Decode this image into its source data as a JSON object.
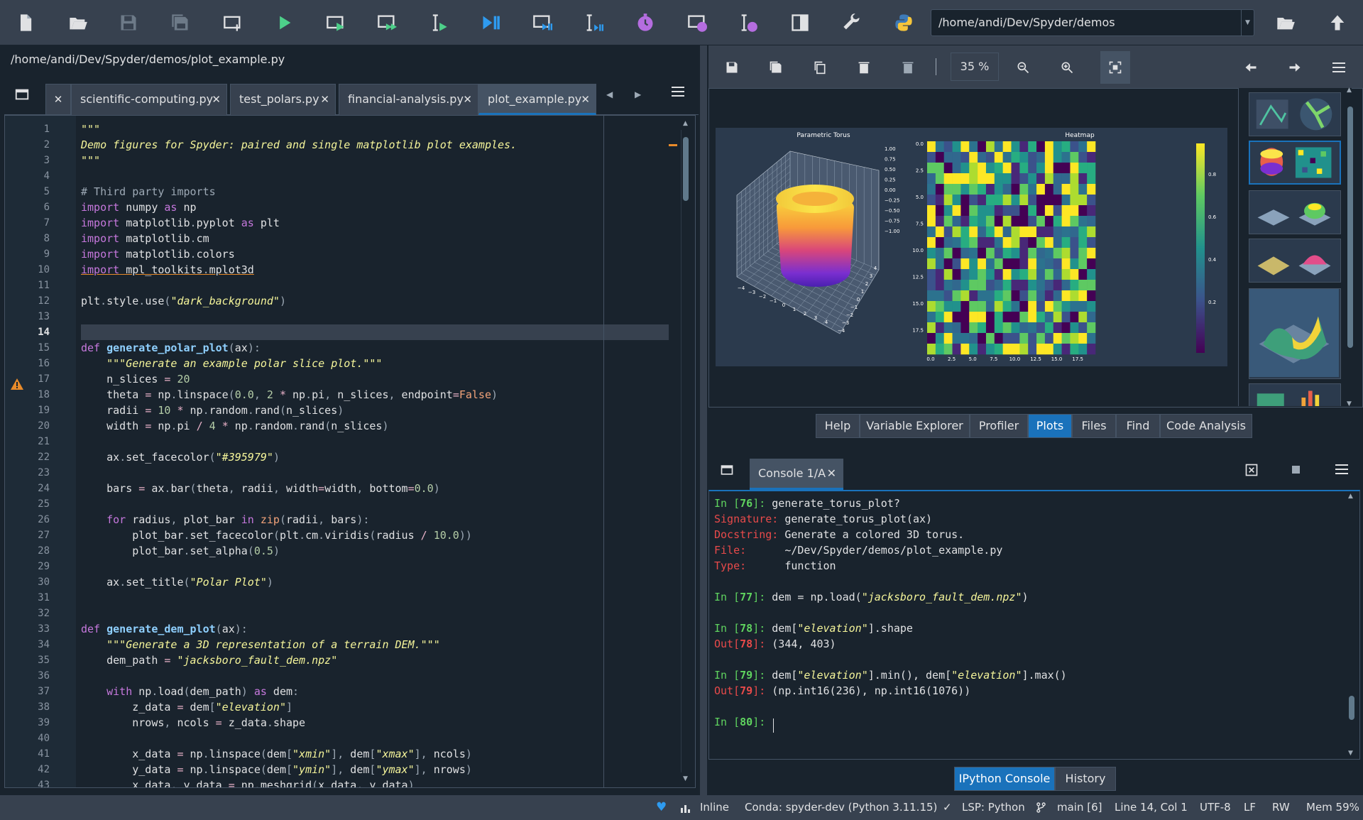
{
  "toolbar": {
    "path": "/home/andi/Dev/Spyder/demos",
    "icons": [
      "new-file-icon",
      "open-file-icon",
      "save-icon",
      "save-all-icon",
      "new-cell-icon",
      "run-icon",
      "run-cell-icon",
      "run-cell-advance-icon",
      "run-selection-icon",
      "debug-icon",
      "debug-cell-icon",
      "debug-selection-icon",
      "profile-icon",
      "profile-cell-icon",
      "profile-selection-icon",
      "maximize-pane-icon",
      "preferences-icon",
      "python-path-icon",
      "browse-folder-icon",
      "parent-dir-icon"
    ]
  },
  "editor": {
    "filepath": "/home/andi/Dev/Spyder/demos/plot_example.py",
    "tabs": [
      {
        "label": "scientific-computing.py"
      },
      {
        "label": "test_polars.py"
      },
      {
        "label": "financial-analysis.py"
      },
      {
        "label": "plot_example.py"
      }
    ],
    "close_glyph": "✕",
    "current_line": 14,
    "line_numbers": [
      "1",
      "2",
      "3",
      "4",
      "5",
      "6",
      "7",
      "8",
      "9",
      "10",
      "11",
      "12",
      "13",
      "14",
      "15",
      "16",
      "17",
      "18",
      "19",
      "20",
      "21",
      "22",
      "23",
      "24",
      "25",
      "26",
      "27",
      "28",
      "29",
      "30",
      "31",
      "32",
      "33",
      "34",
      "35",
      "36",
      "37",
      "38",
      "39",
      "40",
      "41",
      "42",
      "43"
    ],
    "code": [
      [
        [
          "st",
          "\"\"\""
        ]
      ],
      [
        [
          "st",
          "Demo figures for Spyder: paired and single matplotlib plot examples."
        ]
      ],
      [
        [
          "st",
          "\"\"\""
        ]
      ],
      [],
      [
        [
          "cm",
          "# Third party imports"
        ]
      ],
      [
        [
          "kw",
          "import"
        ],
        [
          "t",
          " numpy "
        ],
        [
          "kw",
          "as"
        ],
        [
          "t",
          " np"
        ]
      ],
      [
        [
          "kw",
          "import"
        ],
        [
          "t",
          " matplotlib"
        ],
        [
          "c",
          "."
        ],
        [
          "t",
          "pyplot "
        ],
        [
          "kw",
          "as"
        ],
        [
          "t",
          " plt"
        ]
      ],
      [
        [
          "kw",
          "import"
        ],
        [
          "t",
          " matplotlib"
        ],
        [
          "c",
          "."
        ],
        [
          "t",
          "cm"
        ]
      ],
      [
        [
          "kw",
          "import"
        ],
        [
          "t",
          " matplotlib"
        ],
        [
          "c",
          "."
        ],
        [
          "t",
          "colors"
        ]
      ],
      [
        [
          "kwu",
          "import"
        ],
        [
          "tu",
          " mpl_toolkits"
        ],
        [
          "cu",
          "."
        ],
        [
          "tu",
          "mplot3d"
        ]
      ],
      [],
      [
        [
          "t",
          "plt"
        ],
        [
          "c",
          "."
        ],
        [
          "t",
          "style"
        ],
        [
          "c",
          "."
        ],
        [
          "t",
          "use"
        ],
        [
          "c",
          "("
        ],
        [
          "st",
          "\"dark_background\""
        ],
        [
          "c",
          ")"
        ]
      ],
      [],
      [],
      [
        [
          "kw",
          "def"
        ],
        [
          "t",
          " "
        ],
        [
          "f",
          "generate_polar_plot"
        ],
        [
          "c",
          "("
        ],
        [
          "t",
          "ax"
        ],
        [
          "c",
          "):"
        ]
      ],
      [
        [
          "t",
          "    "
        ],
        [
          "st",
          "\"\"\"Generate an example polar slice plot.\"\"\""
        ]
      ],
      [
        [
          "t",
          "    n_slices "
        ],
        [
          "o",
          "="
        ],
        [
          "t",
          " "
        ],
        [
          "num",
          "20"
        ]
      ],
      [
        [
          "t",
          "    theta "
        ],
        [
          "o",
          "="
        ],
        [
          "t",
          " np"
        ],
        [
          "c",
          "."
        ],
        [
          "t",
          "linspace"
        ],
        [
          "c",
          "("
        ],
        [
          "num",
          "0.0"
        ],
        [
          "c",
          ","
        ],
        [
          "t",
          " "
        ],
        [
          "num",
          "2"
        ],
        [
          "t",
          " "
        ],
        [
          "o",
          "*"
        ],
        [
          "t",
          " np"
        ],
        [
          "c",
          "."
        ],
        [
          "t",
          "pi"
        ],
        [
          "c",
          ","
        ],
        [
          "t",
          " n_slices"
        ],
        [
          "c",
          ","
        ],
        [
          "t",
          " endpoint"
        ],
        [
          "o",
          "="
        ],
        [
          "sy",
          "False"
        ],
        [
          "c",
          ")"
        ]
      ],
      [
        [
          "t",
          "    radii "
        ],
        [
          "o",
          "="
        ],
        [
          "t",
          " "
        ],
        [
          "num",
          "10"
        ],
        [
          "t",
          " "
        ],
        [
          "o",
          "*"
        ],
        [
          "t",
          " np"
        ],
        [
          "c",
          "."
        ],
        [
          "t",
          "random"
        ],
        [
          "c",
          "."
        ],
        [
          "t",
          "rand"
        ],
        [
          "c",
          "("
        ],
        [
          "t",
          "n_slices"
        ],
        [
          "c",
          ")"
        ]
      ],
      [
        [
          "t",
          "    width "
        ],
        [
          "o",
          "="
        ],
        [
          "t",
          " np"
        ],
        [
          "c",
          "."
        ],
        [
          "t",
          "pi "
        ],
        [
          "o",
          "/"
        ],
        [
          "t",
          " "
        ],
        [
          "num",
          "4"
        ],
        [
          "t",
          " "
        ],
        [
          "o",
          "*"
        ],
        [
          "t",
          " np"
        ],
        [
          "c",
          "."
        ],
        [
          "t",
          "random"
        ],
        [
          "c",
          "."
        ],
        [
          "t",
          "rand"
        ],
        [
          "c",
          "("
        ],
        [
          "t",
          "n_slices"
        ],
        [
          "c",
          ")"
        ]
      ],
      [],
      [
        [
          "t",
          "    ax"
        ],
        [
          "c",
          "."
        ],
        [
          "t",
          "set_facecolor"
        ],
        [
          "c",
          "("
        ],
        [
          "st",
          "\"#395979\""
        ],
        [
          "c",
          ")"
        ]
      ],
      [],
      [
        [
          "t",
          "    bars "
        ],
        [
          "o",
          "="
        ],
        [
          "t",
          " ax"
        ],
        [
          "c",
          "."
        ],
        [
          "t",
          "bar"
        ],
        [
          "c",
          "("
        ],
        [
          "t",
          "theta"
        ],
        [
          "c",
          ","
        ],
        [
          "t",
          " radii"
        ],
        [
          "c",
          ","
        ],
        [
          "t",
          " width"
        ],
        [
          "o",
          "="
        ],
        [
          "t",
          "width"
        ],
        [
          "c",
          ","
        ],
        [
          "t",
          " bottom"
        ],
        [
          "o",
          "="
        ],
        [
          "num",
          "0.0"
        ],
        [
          "c",
          ")"
        ]
      ],
      [],
      [
        [
          "t",
          "    "
        ],
        [
          "kw",
          "for"
        ],
        [
          "t",
          " radius"
        ],
        [
          "c",
          ","
        ],
        [
          "t",
          " plot_bar "
        ],
        [
          "kw",
          "in"
        ],
        [
          "t",
          " "
        ],
        [
          "sy",
          "zip"
        ],
        [
          "c",
          "("
        ],
        [
          "t",
          "radii"
        ],
        [
          "c",
          ","
        ],
        [
          "t",
          " bars"
        ],
        [
          "c",
          "):"
        ]
      ],
      [
        [
          "t",
          "        plot_bar"
        ],
        [
          "c",
          "."
        ],
        [
          "t",
          "set_facecolor"
        ],
        [
          "c",
          "("
        ],
        [
          "t",
          "plt"
        ],
        [
          "c",
          "."
        ],
        [
          "t",
          "cm"
        ],
        [
          "c",
          "."
        ],
        [
          "t",
          "viridis"
        ],
        [
          "c",
          "("
        ],
        [
          "t",
          "radius "
        ],
        [
          "o",
          "/"
        ],
        [
          "t",
          " "
        ],
        [
          "num",
          "10.0"
        ],
        [
          "c",
          "))"
        ]
      ],
      [
        [
          "t",
          "        plot_bar"
        ],
        [
          "c",
          "."
        ],
        [
          "t",
          "set_alpha"
        ],
        [
          "c",
          "("
        ],
        [
          "num",
          "0.5"
        ],
        [
          "c",
          ")"
        ]
      ],
      [],
      [
        [
          "t",
          "    ax"
        ],
        [
          "c",
          "."
        ],
        [
          "t",
          "set_title"
        ],
        [
          "c",
          "("
        ],
        [
          "st",
          "\"Polar Plot\""
        ],
        [
          "c",
          ")"
        ]
      ],
      [],
      [],
      [
        [
          "kw",
          "def"
        ],
        [
          "t",
          " "
        ],
        [
          "f",
          "generate_dem_plot"
        ],
        [
          "c",
          "("
        ],
        [
          "t",
          "ax"
        ],
        [
          "c",
          "):"
        ]
      ],
      [
        [
          "t",
          "    "
        ],
        [
          "st",
          "\"\"\"Generate a 3D representation of a terrain DEM.\"\"\""
        ]
      ],
      [
        [
          "t",
          "    dem_path "
        ],
        [
          "o",
          "="
        ],
        [
          "t",
          " "
        ],
        [
          "st",
          "\"jacksboro_fault_dem.npz\""
        ]
      ],
      [],
      [
        [
          "t",
          "    "
        ],
        [
          "kw",
          "with"
        ],
        [
          "t",
          " np"
        ],
        [
          "c",
          "."
        ],
        [
          "t",
          "load"
        ],
        [
          "c",
          "("
        ],
        [
          "t",
          "dem_path"
        ],
        [
          "c",
          ")"
        ],
        [
          "t",
          " "
        ],
        [
          "kw",
          "as"
        ],
        [
          "t",
          " dem"
        ],
        [
          "c",
          ":"
        ]
      ],
      [
        [
          "t",
          "        z_data "
        ],
        [
          "o",
          "="
        ],
        [
          "t",
          " dem"
        ],
        [
          "c",
          "["
        ],
        [
          "st",
          "\"elevation\""
        ],
        [
          "c",
          "]"
        ]
      ],
      [
        [
          "t",
          "        nrows"
        ],
        [
          "c",
          ","
        ],
        [
          "t",
          " ncols "
        ],
        [
          "o",
          "="
        ],
        [
          "t",
          " z_data"
        ],
        [
          "c",
          "."
        ],
        [
          "t",
          "shape"
        ]
      ],
      [],
      [
        [
          "t",
          "        x_data "
        ],
        [
          "o",
          "="
        ],
        [
          "t",
          " np"
        ],
        [
          "c",
          "."
        ],
        [
          "t",
          "linspace"
        ],
        [
          "c",
          "("
        ],
        [
          "t",
          "dem"
        ],
        [
          "c",
          "["
        ],
        [
          "st",
          "\"xmin\""
        ],
        [
          "c",
          "],"
        ],
        [
          "t",
          " dem"
        ],
        [
          "c",
          "["
        ],
        [
          "st",
          "\"xmax\""
        ],
        [
          "c",
          "],"
        ],
        [
          "t",
          " ncols"
        ],
        [
          "c",
          ")"
        ]
      ],
      [
        [
          "t",
          "        y_data "
        ],
        [
          "o",
          "="
        ],
        [
          "t",
          " np"
        ],
        [
          "c",
          "."
        ],
        [
          "t",
          "linspace"
        ],
        [
          "c",
          "("
        ],
        [
          "t",
          "dem"
        ],
        [
          "c",
          "["
        ],
        [
          "st",
          "\"ymin\""
        ],
        [
          "c",
          "],"
        ],
        [
          "t",
          " dem"
        ],
        [
          "c",
          "["
        ],
        [
          "st",
          "\"ymax\""
        ],
        [
          "c",
          "],"
        ],
        [
          "t",
          " nrows"
        ],
        [
          "c",
          ")"
        ]
      ],
      [
        [
          "t",
          "        x_data"
        ],
        [
          "c",
          ","
        ],
        [
          "t",
          " y_data "
        ],
        [
          "o",
          "="
        ],
        [
          "t",
          " np"
        ],
        [
          "c",
          "."
        ],
        [
          "t",
          "meshgrid"
        ],
        [
          "c",
          "("
        ],
        [
          "t",
          "x_data"
        ],
        [
          "c",
          ","
        ],
        [
          "t",
          " y_data"
        ],
        [
          "c",
          ")"
        ]
      ]
    ]
  },
  "plots": {
    "zoom": "35 %",
    "figure": {
      "left_title": "Parametric Torus",
      "right_title": "Heatmap",
      "z_ticks": [
        "1.00",
        "0.75",
        "0.50",
        "0.25",
        "0.00",
        "−0.25",
        "−0.50",
        "−0.75",
        "−1.00"
      ],
      "x3d_ticks": [
        "−4",
        "−3",
        "−2",
        "−1",
        "0",
        "1",
        "2",
        "3",
        "4"
      ],
      "y3d_ticks": [
        "4",
        "3",
        "2",
        "1",
        "0",
        "−1",
        "−2",
        "−3",
        "−4"
      ],
      "heat_y_ticks": [
        "0.0",
        "2.5",
        "5.0",
        "7.5",
        "10.0",
        "12.5",
        "15.0",
        "17.5"
      ],
      "heat_x_ticks": [
        "0.0",
        "2.5",
        "5.0",
        "7.5",
        "10.0",
        "12.5",
        "15.0",
        "17.5"
      ],
      "colorbar_ticks": [
        "0.8",
        "0.6",
        "0.4",
        "0.2"
      ]
    }
  },
  "pane_tabs": [
    {
      "label": "Help"
    },
    {
      "label": "Variable Explorer"
    },
    {
      "label": "Profiler"
    },
    {
      "label": "Plots"
    },
    {
      "label": "Files"
    },
    {
      "label": "Find"
    },
    {
      "label": "Code Analysis"
    }
  ],
  "console": {
    "tab_label": "Console 1/A",
    "lines": [
      [
        [
          "g",
          "In ["
        ],
        [
          "gb",
          "76"
        ],
        [
          "g",
          "]: "
        ],
        [
          "t",
          "generate_torus_plot?"
        ]
      ],
      [
        [
          "r",
          "Signature: "
        ],
        [
          "t",
          "generate_torus_plot(ax)"
        ]
      ],
      [
        [
          "r",
          "Docstring: "
        ],
        [
          "t",
          "Generate a colored 3D torus."
        ]
      ],
      [
        [
          "r",
          "File:      "
        ],
        [
          "t",
          "~/Dev/Spyder/demos/plot_example.py"
        ]
      ],
      [
        [
          "r",
          "Type:      "
        ],
        [
          "t",
          "function"
        ]
      ],
      [],
      [
        [
          "g",
          "In ["
        ],
        [
          "gb",
          "77"
        ],
        [
          "g",
          "]: "
        ],
        [
          "t",
          "dem = np.load("
        ],
        [
          "st",
          "\"jacksboro_fault_dem.npz\""
        ],
        [
          "t",
          ")"
        ]
      ],
      [],
      [
        [
          "g",
          "In ["
        ],
        [
          "gb",
          "78"
        ],
        [
          "g",
          "]: "
        ],
        [
          "t",
          "dem["
        ],
        [
          "st",
          "\"elevation\""
        ],
        [
          "t",
          "].shape"
        ]
      ],
      [
        [
          "r",
          "Out["
        ],
        [
          "rb",
          "78"
        ],
        [
          "r",
          "]: "
        ],
        [
          "t",
          "(344, 403)"
        ]
      ],
      [],
      [
        [
          "g",
          "In ["
        ],
        [
          "gb",
          "79"
        ],
        [
          "g",
          "]: "
        ],
        [
          "t",
          "dem["
        ],
        [
          "st",
          "\"elevation\""
        ],
        [
          "t",
          "].min(), dem["
        ],
        [
          "st",
          "\"elevation\""
        ],
        [
          "t",
          "].max()"
        ]
      ],
      [
        [
          "r",
          "Out["
        ],
        [
          "rb",
          "79"
        ],
        [
          "r",
          "]: "
        ],
        [
          "t",
          "(np.int16(236), np.int16(1076))"
        ]
      ],
      [],
      [
        [
          "g",
          "In ["
        ],
        [
          "gb",
          "80"
        ],
        [
          "g",
          "]: "
        ]
      ]
    ]
  },
  "console_tabs": [
    {
      "label": "IPython Console"
    },
    {
      "label": "History"
    }
  ],
  "status": {
    "inline": "Inline",
    "conda": "Conda: spyder-dev (Python 3.11.15)",
    "lsp": "LSP: Python",
    "git": "main [6]",
    "cursor": "Line 14, Col 1",
    "encoding": "UTF-8",
    "eol": "LF",
    "rw": "RW",
    "mem": "Mem 59%"
  },
  "colors": {
    "accent": "#1a72bb",
    "background": "#19232d",
    "panel": "#37414f",
    "figure_bg": "#2b3a4d"
  }
}
